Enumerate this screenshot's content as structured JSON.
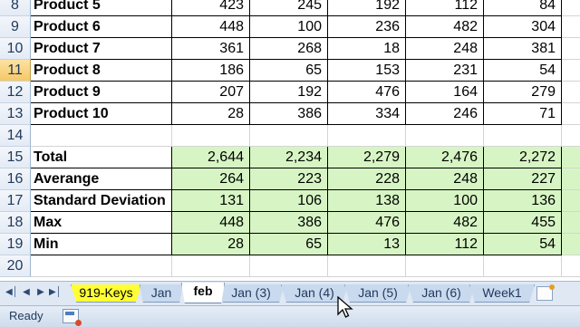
{
  "sheet": {
    "rows": [
      {
        "num": "8",
        "label": "Product 5",
        "values": [
          "423",
          "245",
          "192",
          "112",
          "84"
        ],
        "kind": "data"
      },
      {
        "num": "9",
        "label": "Product 6",
        "values": [
          "448",
          "100",
          "236",
          "482",
          "304"
        ],
        "kind": "data"
      },
      {
        "num": "10",
        "label": "Product 7",
        "values": [
          "361",
          "268",
          "18",
          "248",
          "381"
        ],
        "kind": "data"
      },
      {
        "num": "11",
        "label": "Product 8",
        "values": [
          "186",
          "65",
          "153",
          "231",
          "54"
        ],
        "kind": "data",
        "active": true
      },
      {
        "num": "12",
        "label": "Product 9",
        "values": [
          "207",
          "192",
          "476",
          "164",
          "279"
        ],
        "kind": "data"
      },
      {
        "num": "13",
        "label": "Product 10",
        "values": [
          "28",
          "386",
          "334",
          "246",
          "71"
        ],
        "kind": "data"
      },
      {
        "num": "14",
        "label": "",
        "values": [
          "",
          "",
          "",
          "",
          ""
        ],
        "kind": "blank"
      },
      {
        "num": "15",
        "label": "Total",
        "values": [
          "2,644",
          "2,234",
          "2,279",
          "2,476",
          "2,272"
        ],
        "kind": "stat"
      },
      {
        "num": "16",
        "label": "Averange",
        "values": [
          "264",
          "223",
          "228",
          "248",
          "227"
        ],
        "kind": "stat"
      },
      {
        "num": "17",
        "label": "Standard Deviation",
        "values": [
          "131",
          "106",
          "138",
          "100",
          "136"
        ],
        "kind": "stat"
      },
      {
        "num": "18",
        "label": "Max",
        "values": [
          "448",
          "386",
          "476",
          "482",
          "455"
        ],
        "kind": "stat"
      },
      {
        "num": "19",
        "label": "Min",
        "values": [
          "28",
          "65",
          "13",
          "112",
          "54"
        ],
        "kind": "stat"
      },
      {
        "num": "20",
        "label": "",
        "values": [
          "",
          "",
          "",
          "",
          ""
        ],
        "kind": "blank"
      }
    ]
  },
  "tabs": [
    {
      "label": "919-Keys",
      "style": "keys"
    },
    {
      "label": "Jan",
      "style": "normal"
    },
    {
      "label": "feb",
      "style": "active"
    },
    {
      "label": "Jan (3)",
      "style": "normal"
    },
    {
      "label": "Jan (4)",
      "style": "normal"
    },
    {
      "label": "Jan (5)",
      "style": "normal"
    },
    {
      "label": "Jan (6)",
      "style": "normal"
    },
    {
      "label": "Week1",
      "style": "normal"
    }
  ],
  "nav_icons": [
    "first-sheet-icon",
    "prev-sheet-icon",
    "next-sheet-icon",
    "last-sheet-icon"
  ],
  "status": {
    "text": "Ready",
    "macro_icon": "record-macro-icon"
  },
  "colors": {
    "stat_fill": "#d7f5c4",
    "keys_tab": "#ffff33",
    "active_row_header": "#f6c866"
  }
}
